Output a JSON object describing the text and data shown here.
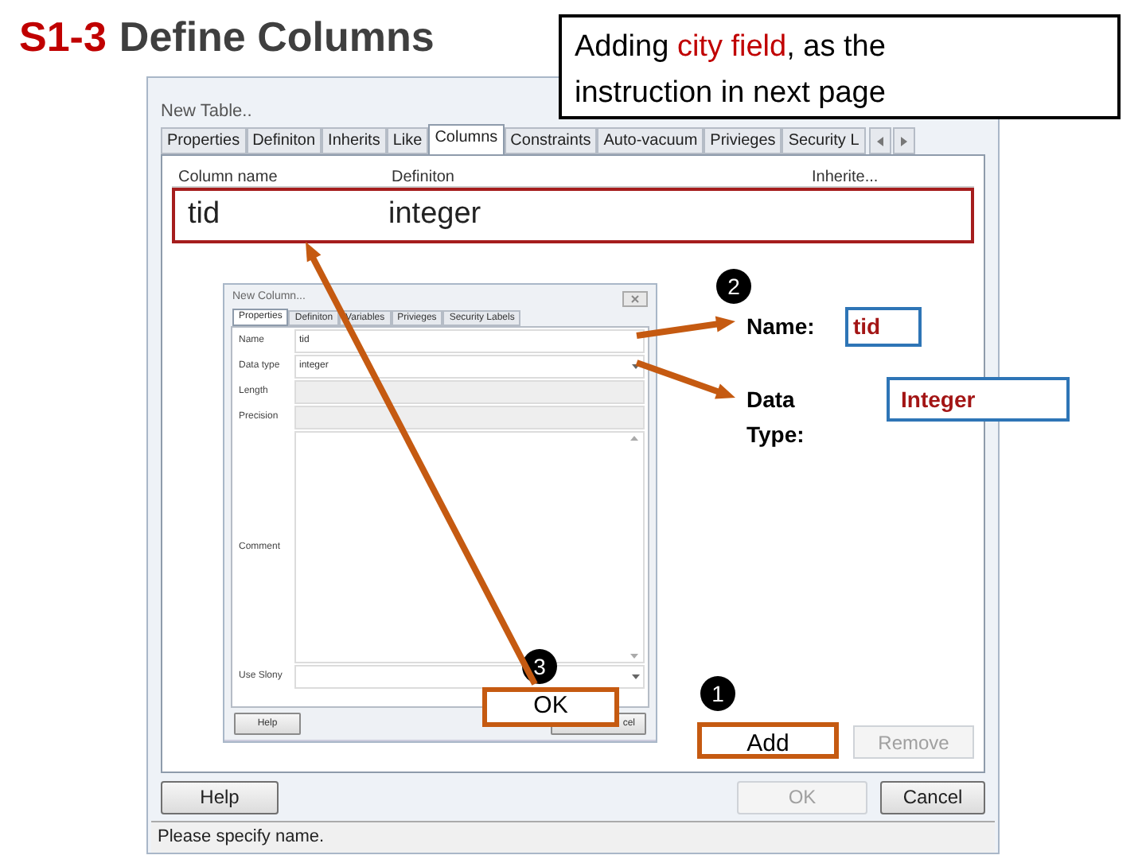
{
  "title": {
    "code": "S1-3",
    "text": "Define Columns"
  },
  "callout": {
    "parts": [
      {
        "text": "Adding ",
        "highlight": false
      },
      {
        "text": "city field",
        "highlight": true
      },
      {
        "text": ", as the instruction in next page",
        "highlight": false
      }
    ]
  },
  "table_window": {
    "title": "New Table..",
    "tabs": [
      {
        "label": "Properties",
        "selected": false
      },
      {
        "label": "Definiton",
        "selected": false
      },
      {
        "label": "Inherits",
        "selected": false
      },
      {
        "label": "Like",
        "selected": false
      },
      {
        "label": "Columns",
        "selected": true
      },
      {
        "label": "Constraints",
        "selected": false
      },
      {
        "label": "Auto-vacuum",
        "selected": false
      },
      {
        "label": "Privieges",
        "selected": false
      },
      {
        "label": "Security L",
        "selected": false
      }
    ],
    "columns": [
      "Column name",
      "Definiton",
      "Inherite..."
    ],
    "rows": [
      {
        "name": "tid",
        "definition": "integer"
      }
    ],
    "list_buttons": [
      {
        "label": "Add",
        "disabled": false,
        "highlighted": true
      },
      {
        "label": "Remove",
        "disabled": true,
        "highlighted": false
      }
    ],
    "buttons": [
      {
        "label": "Help",
        "disabled": false
      },
      {
        "label": "OK",
        "disabled": true
      },
      {
        "label": "Cancel",
        "disabled": false
      }
    ],
    "status": "Please specify name."
  },
  "column_dialog": {
    "title": "New Column...",
    "tabs": [
      {
        "label": "Properties",
        "selected": true
      },
      {
        "label": "Definiton",
        "selected": false
      },
      {
        "label": "Variables",
        "selected": false
      },
      {
        "label": "Privieges",
        "selected": false
      },
      {
        "label": "Security Labels",
        "selected": false
      }
    ],
    "fields": [
      {
        "label": "Name",
        "value": "tid",
        "kind": "text",
        "disabled": false
      },
      {
        "label": "Data type",
        "value": "integer",
        "kind": "dropdown",
        "disabled": false
      },
      {
        "label": "Length",
        "kind": "text",
        "disabled": true
      },
      {
        "label": "Precision",
        "kind": "text",
        "disabled": true
      },
      {
        "label": "Comment",
        "kind": "textarea",
        "disabled": false
      },
      {
        "label": "Use Slony",
        "kind": "dropdown",
        "disabled": false
      }
    ],
    "buttons": [
      {
        "label": "Help"
      },
      {
        "label": "cel"
      }
    ],
    "ok_callout": "OK"
  },
  "annotations": {
    "badges": [
      "2",
      "3",
      "1"
    ],
    "name_label": "Name:",
    "name_value": "tid",
    "type_label": "Data Type:",
    "type_value": "Integer"
  }
}
